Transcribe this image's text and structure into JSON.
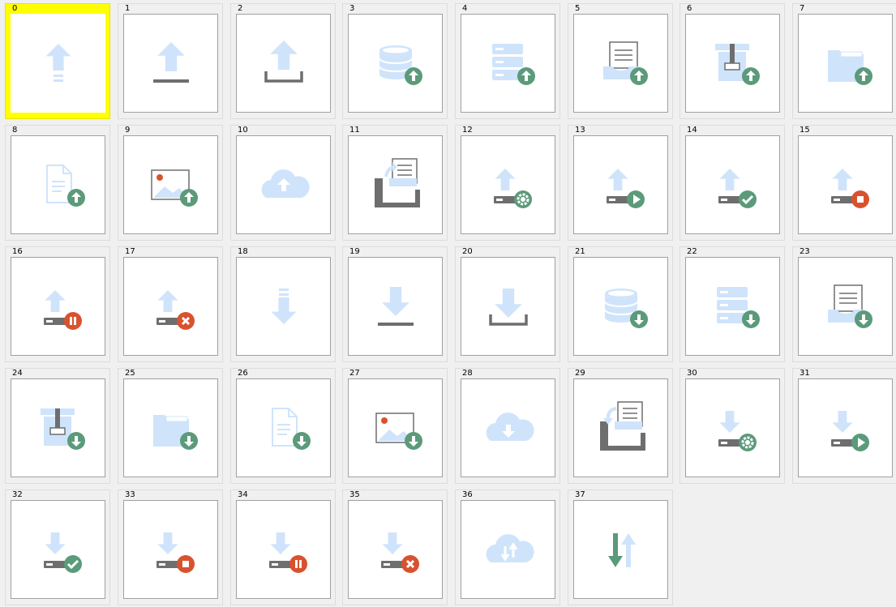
{
  "selected_index": 0,
  "colors": {
    "light_blue": "#cfe4fb",
    "green": "#5b9a7a",
    "red": "#d9522f",
    "gray": "#6e6e6e",
    "highlight": "#ffff00"
  },
  "icons": [
    {
      "label": "0",
      "icon": "upload-arrow-lines-icon"
    },
    {
      "label": "1",
      "icon": "upload-bar-icon"
    },
    {
      "label": "2",
      "icon": "upload-tray-icon"
    },
    {
      "label": "3",
      "icon": "database-upload-icon"
    },
    {
      "label": "4",
      "icon": "server-upload-icon"
    },
    {
      "label": "5",
      "icon": "inbox-document-upload-icon"
    },
    {
      "label": "6",
      "icon": "archive-box-upload-icon"
    },
    {
      "label": "7",
      "icon": "folder-upload-icon"
    },
    {
      "label": "8",
      "icon": "document-upload-icon"
    },
    {
      "label": "9",
      "icon": "image-upload-icon"
    },
    {
      "label": "10",
      "icon": "cloud-upload-icon"
    },
    {
      "label": "11",
      "icon": "export-tray-icon"
    },
    {
      "label": "12",
      "icon": "upload-settings-icon"
    },
    {
      "label": "13",
      "icon": "upload-play-icon"
    },
    {
      "label": "14",
      "icon": "upload-check-icon"
    },
    {
      "label": "15",
      "icon": "upload-stop-icon"
    },
    {
      "label": "16",
      "icon": "upload-pause-icon"
    },
    {
      "label": "17",
      "icon": "upload-cancel-icon"
    },
    {
      "label": "18",
      "icon": "download-arrow-lines-icon"
    },
    {
      "label": "19",
      "icon": "download-bar-icon"
    },
    {
      "label": "20",
      "icon": "download-tray-icon"
    },
    {
      "label": "21",
      "icon": "database-download-icon"
    },
    {
      "label": "22",
      "icon": "server-download-icon"
    },
    {
      "label": "23",
      "icon": "inbox-document-download-icon"
    },
    {
      "label": "24",
      "icon": "archive-box-download-icon"
    },
    {
      "label": "25",
      "icon": "folder-download-icon"
    },
    {
      "label": "26",
      "icon": "document-download-icon"
    },
    {
      "label": "27",
      "icon": "image-download-icon"
    },
    {
      "label": "28",
      "icon": "cloud-download-icon"
    },
    {
      "label": "29",
      "icon": "import-tray-icon"
    },
    {
      "label": "30",
      "icon": "download-settings-icon"
    },
    {
      "label": "31",
      "icon": "download-play-icon"
    },
    {
      "label": "32",
      "icon": "download-check-icon"
    },
    {
      "label": "33",
      "icon": "download-stop-icon"
    },
    {
      "label": "34",
      "icon": "download-pause-icon"
    },
    {
      "label": "35",
      "icon": "download-cancel-icon"
    },
    {
      "label": "36",
      "icon": "cloud-sync-icon"
    },
    {
      "label": "37",
      "icon": "transfer-arrows-icon"
    }
  ]
}
